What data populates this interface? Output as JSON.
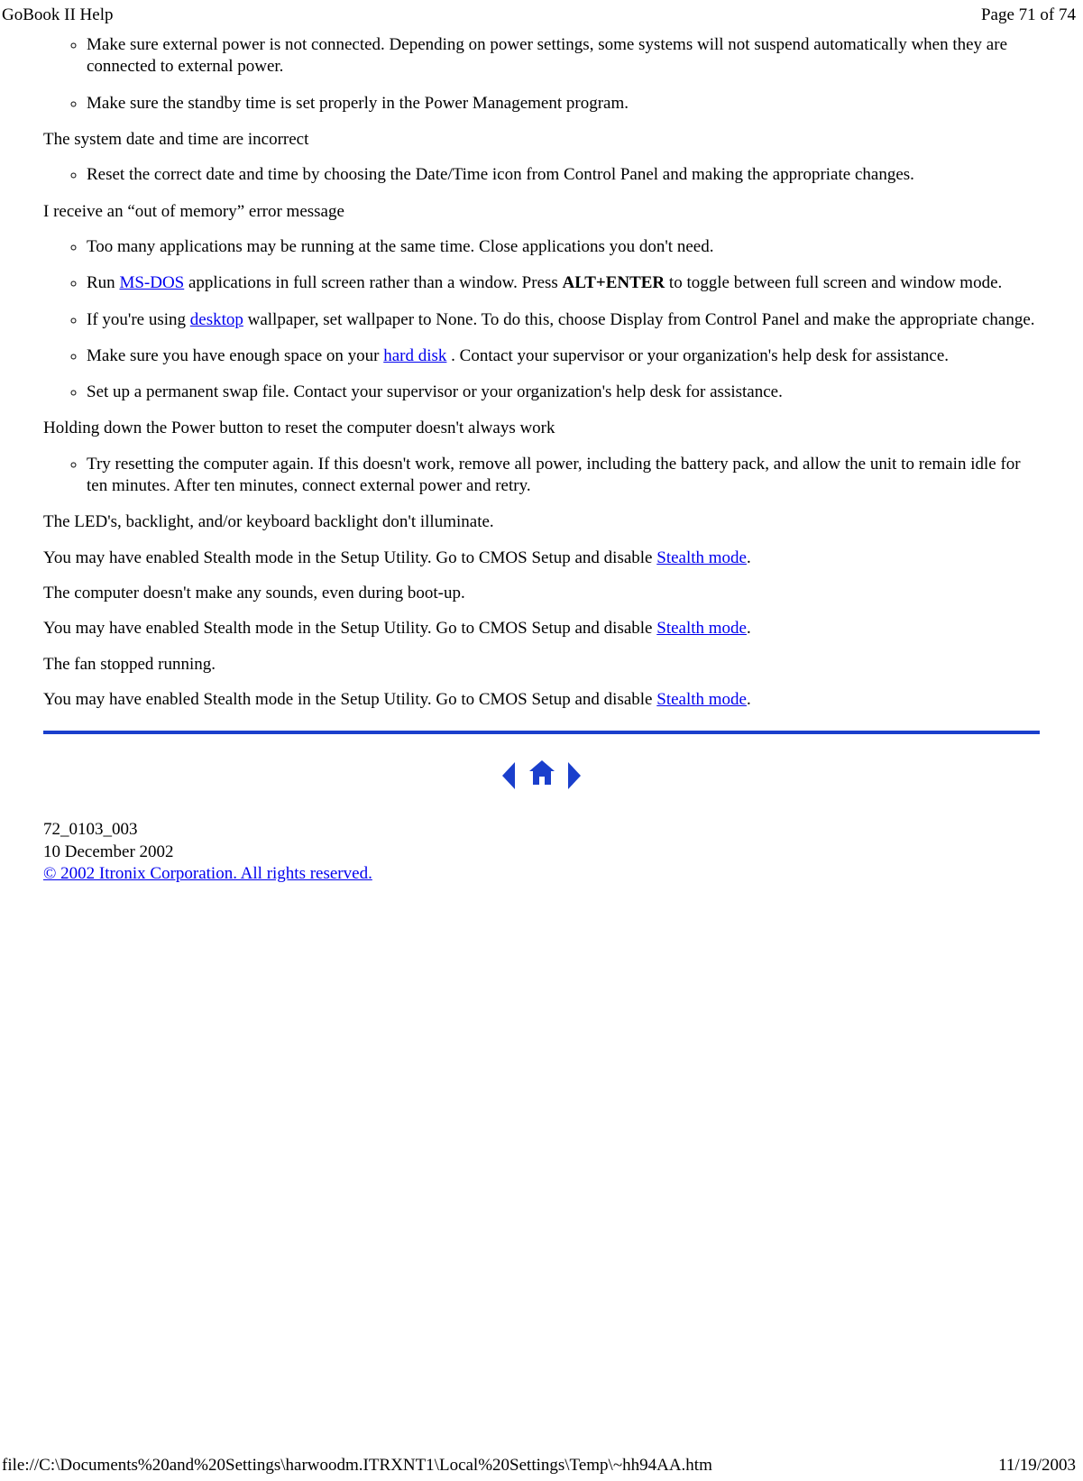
{
  "header": {
    "title": "GoBook II Help",
    "page_info": "Page 71 of 74"
  },
  "sections": {
    "s1": {
      "items": {
        "i1": "Make sure external power is not connected. Depending on power settings, some systems will not suspend automatically when they are connected to external power.",
        "i2": "Make sure the standby time is set properly in the Power Management program."
      }
    },
    "s2": {
      "title": "The system date and time are incorrect",
      "items": {
        "i1": "Reset the correct date and time by choosing the Date/Time icon from Control Panel and making the appropriate changes."
      }
    },
    "s3": {
      "title": "I receive an “out of memory” error message",
      "items": {
        "i1": "Too many applications may be running at the same time. Close applications you don't need.",
        "i2a": "Run ",
        "i2link": "MS-DOS",
        "i2b": " applications in full screen rather than a window. Press ",
        "i2bold": "ALT+ENTER",
        "i2c": " to toggle between full screen and window mode.",
        "i3a": "If you're using ",
        "i3link": "desktop",
        "i3b": " wallpaper, set wallpaper to None. To do this, choose Display from Control Panel and make the appropriate change.",
        "i4a": "Make sure you have enough space on your ",
        "i4link": "hard disk",
        "i4b": " . Contact your supervisor or your organization's help desk for assistance.",
        "i5": "Set up a permanent swap file. Contact your supervisor or your organization's help desk for assistance."
      }
    },
    "s4": {
      "title": "Holding down the Power button to reset the computer doesn't always work",
      "items": {
        "i1": "Try resetting the computer again. If this doesn't work, remove all power, including the battery pack, and allow the unit to remain idle for ten minutes. After ten minutes, connect external power and retry."
      }
    },
    "s5": {
      "p1": "The LED's, backlight, and/or keyboard backlight don't illuminate.",
      "p2a": "You may have enabled Stealth mode in the Setup Utility.  Go to CMOS Setup and disable ",
      "p2link": "Stealth mode",
      "p2b": ".",
      "p3": "The computer doesn't make any sounds, even during boot-up.",
      "p4a": "You may have enabled  Stealth mode in the Setup Utility.  Go to CMOS Setup and disable ",
      "p4link": "Stealth mode",
      "p4b": ".",
      "p5": "The fan stopped running.",
      "p6a": "You may have enabled Stealth mode in the Setup Utility.  Go to CMOS Setup and disable ",
      "p6link": "Stealth mode",
      "p6b": "."
    }
  },
  "doc_footer": {
    "doc_id": "72_0103_003",
    "date": "10 December 2002",
    "copyright": "© 2002 Itronix Corporation.  All rights reserved."
  },
  "page_footer": {
    "path": "file://C:\\Documents%20and%20Settings\\harwoodm.ITRXNT1\\Local%20Settings\\Temp\\~hh94AA.htm",
    "date": "11/19/2003"
  }
}
